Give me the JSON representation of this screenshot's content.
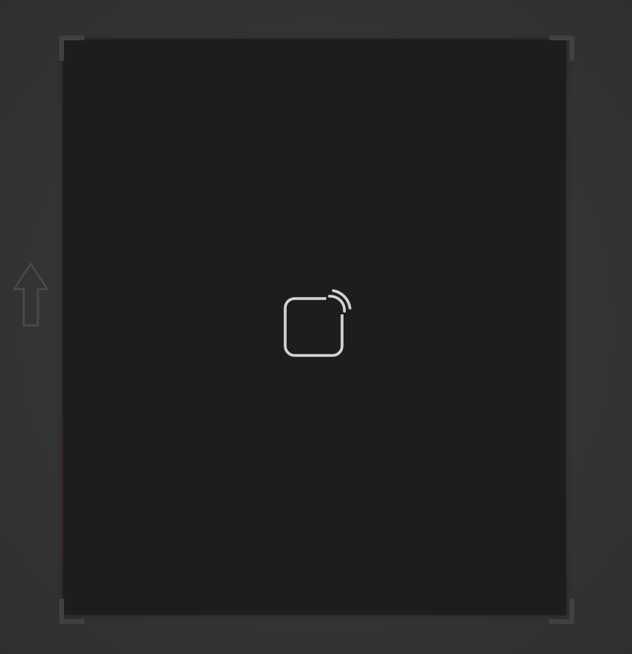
{
  "screen": {
    "background_color": "#353535",
    "frame_color": "#1d1d1d",
    "corner_bracket_color": "#404040",
    "icon_color": "#d4d4d4"
  },
  "icons": {
    "arrow": "arrow-up-icon",
    "center": "tap-to-pay-icon"
  }
}
